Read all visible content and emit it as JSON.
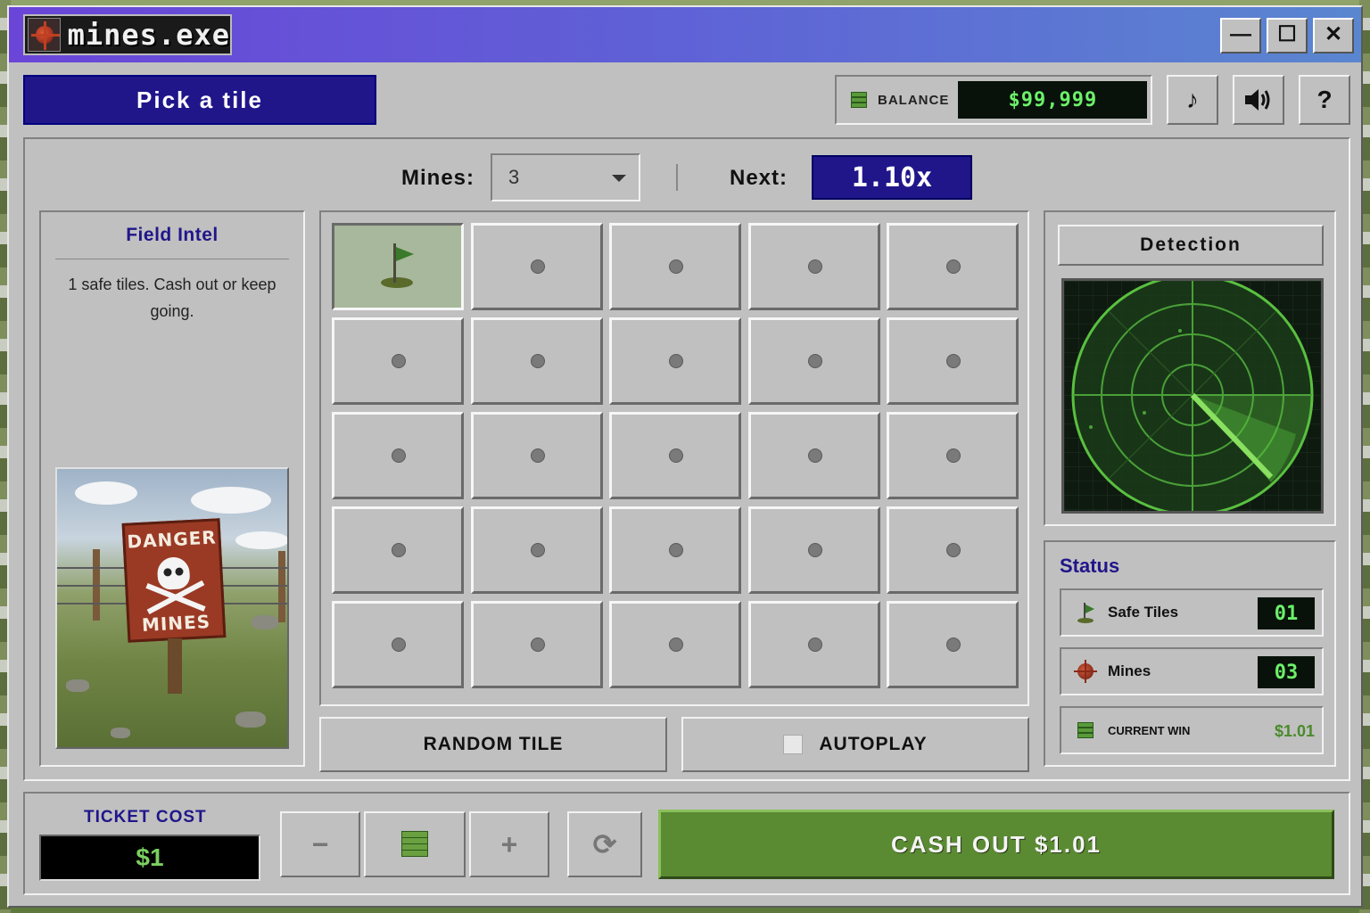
{
  "window": {
    "title": "mines.exe",
    "controls": {
      "minimize": "—",
      "maximize": "☐",
      "close": "✕"
    }
  },
  "header": {
    "status_banner": "Pick a tile",
    "balance_label": "BALANCE",
    "balance_value": "$99,999",
    "music_button": "♪",
    "sound_button": "🔊",
    "help_button": "?"
  },
  "controls": {
    "mines_label": "Mines:",
    "mines_value": "3",
    "next_label": "Next:",
    "next_value": "1.10x"
  },
  "intel": {
    "title": "Field Intel",
    "message": "1 safe tiles. Cash out or keep going.",
    "sign_top": "DANGER",
    "sign_bottom": "MINES"
  },
  "grid": {
    "rows": 5,
    "cols": 5,
    "tiles": [
      "flag",
      "hidden",
      "hidden",
      "hidden",
      "hidden",
      "hidden",
      "hidden",
      "hidden",
      "hidden",
      "hidden",
      "hidden",
      "hidden",
      "hidden",
      "hidden",
      "hidden",
      "hidden",
      "hidden",
      "hidden",
      "hidden",
      "hidden",
      "hidden",
      "hidden",
      "hidden",
      "hidden",
      "hidden"
    ]
  },
  "actions": {
    "random_tile": "RANDOM TILE",
    "autoplay": "AUTOPLAY",
    "autoplay_checked": false
  },
  "detection": {
    "title": "Detection"
  },
  "status": {
    "title": "Status",
    "safe_tiles_label": "Safe Tiles",
    "safe_tiles_value": "01",
    "mines_label": "Mines",
    "mines_value": "03",
    "current_win_label": "CURRENT WIN",
    "current_win_value": "$1.01"
  },
  "bottom": {
    "ticket_label": "TICKET COST",
    "ticket_value": "$1",
    "minus": "−",
    "plus": "+",
    "reset": "⟳",
    "cashout": "CASH OUT $1.01"
  },
  "colors": {
    "accent_blue": "#20168a",
    "led_green": "#6cf06a",
    "cashout_green": "#5a8a32"
  }
}
